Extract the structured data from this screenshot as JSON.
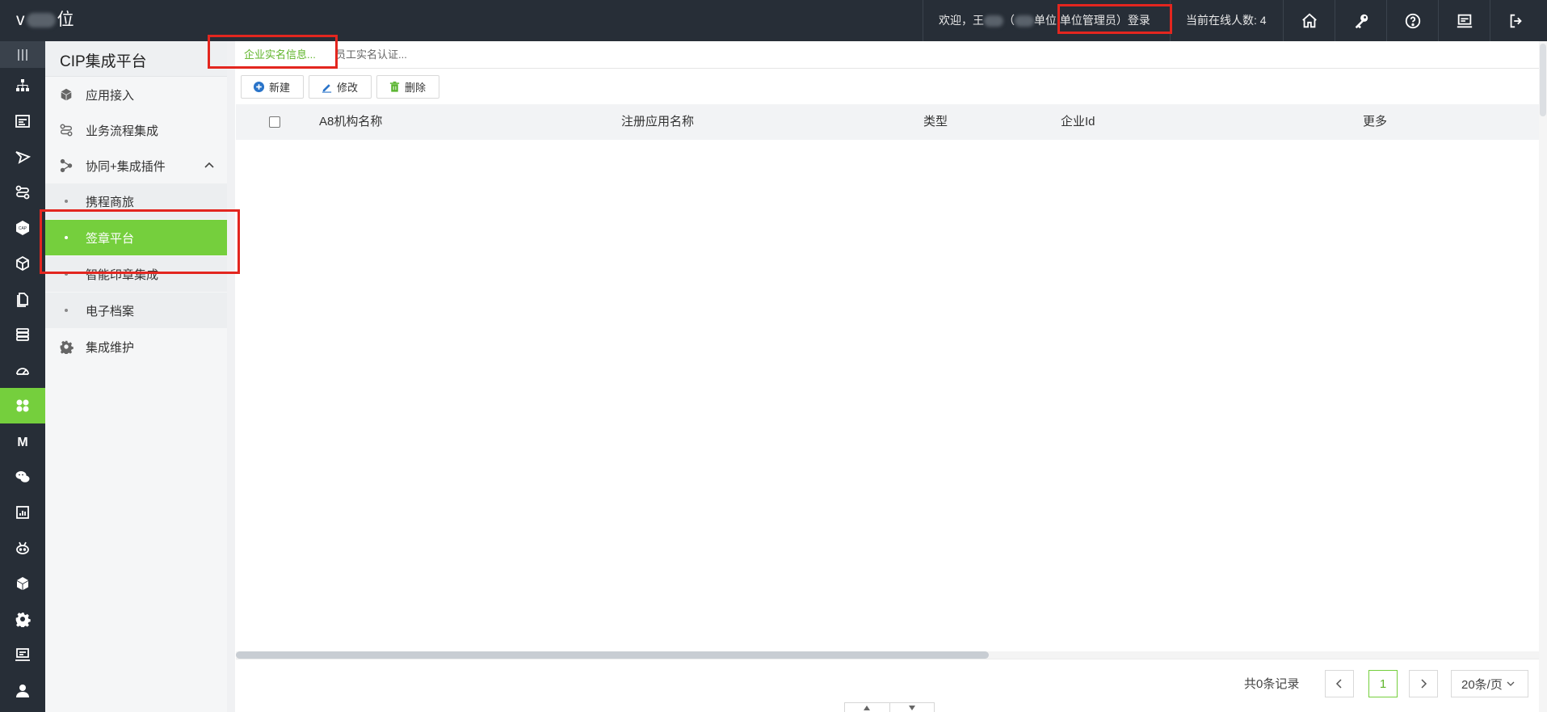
{
  "header": {
    "brand_prefix": "v",
    "brand_suffix": "位",
    "welcome_prefix": "欢迎，王",
    "welcome_mid": "（",
    "welcome_role": "单位 单位管理员）登录",
    "online_label": "当前在线人数: 4",
    "buttons": [
      "home-icon",
      "key-icon",
      "help-icon",
      "screen-icon",
      "logout-icon"
    ]
  },
  "rail": {
    "icons": [
      "menu-icon",
      "org-chart-icon",
      "form-icon",
      "send-icon",
      "flow-icon",
      "cap-icon",
      "cube-icon",
      "document-icon",
      "database-icon",
      "gauge-icon",
      "plugin-icon",
      "m-icon",
      "wechat-icon",
      "report-icon",
      "robot-icon",
      "box-icon",
      "gear-icon",
      "monitor-icon",
      "user-icon"
    ],
    "cap_label": "CAP",
    "m_label": "M"
  },
  "sidebar": {
    "title": "CIP集成平台",
    "items": [
      {
        "label": "应用接入",
        "icon": "cube-icon"
      },
      {
        "label": "业务流程集成",
        "icon": "flow-icon"
      },
      {
        "label": "协同+集成插件",
        "icon": "plugin-icon"
      },
      {
        "label": "集成维护",
        "icon": "gear-icon"
      }
    ],
    "subitems": [
      {
        "label": "携程商旅"
      },
      {
        "label": "签章平台"
      },
      {
        "label": "智能印章集成"
      },
      {
        "label": "电子档案"
      }
    ]
  },
  "tabs": [
    {
      "label": "企业实名信息..."
    },
    {
      "label": "员工实名认证..."
    }
  ],
  "toolbar": {
    "new_label": "新建",
    "edit_label": "修改",
    "delete_label": "删除"
  },
  "table": {
    "columns": [
      "A8机构名称",
      "注册应用名称",
      "类型",
      "企业Id",
      "更多"
    ],
    "rows": []
  },
  "pagination": {
    "total_label": "共0条记录",
    "current_page": "1",
    "page_size": "20条/页"
  },
  "colors": {
    "accent": "#75cf3d",
    "topbar": "#272e37",
    "annotation": "#e3261f"
  }
}
